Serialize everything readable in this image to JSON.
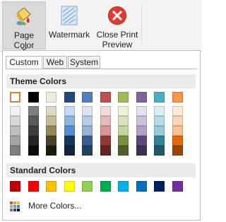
{
  "ribbon": {
    "buttons": [
      {
        "label": "Page Color",
        "icon": "paint-bucket-icon"
      },
      {
        "label": "Watermark",
        "icon": "watermark-icon"
      },
      {
        "label": "Close Print\nPreview",
        "icon": "close-icon"
      }
    ]
  },
  "tabs": [
    "Custom",
    "Web",
    "System"
  ],
  "sections": {
    "theme_title": "Theme Colors",
    "standard_title": "Standard Colors"
  },
  "theme_colors": {
    "top_row": [
      "#ffffff",
      "#000000",
      "#eeece1",
      "#1f497d",
      "#4f81bd",
      "#c0504d",
      "#9bbb59",
      "#8064a2",
      "#4bacc6",
      "#f79646"
    ],
    "shades": [
      [
        "#f2f2f2",
        "#d8d8d8",
        "#bfbfbf",
        "#a5a5a5",
        "#7f7f7f"
      ],
      [
        "#7f7f7f",
        "#595959",
        "#3f3f3f",
        "#262626",
        "#0c0c0c"
      ],
      [
        "#ddd9c3",
        "#c4bd97",
        "#938953",
        "#494429",
        "#1d1b10"
      ],
      [
        "#c6d9f0",
        "#8db3e2",
        "#548dd4",
        "#17365d",
        "#0f243e"
      ],
      [
        "#dbe5f1",
        "#b8cce4",
        "#95b3d7",
        "#366092",
        "#244061"
      ],
      [
        "#f2dcdb",
        "#e5b9b7",
        "#d99694",
        "#953734",
        "#632423"
      ],
      [
        "#ebf1dd",
        "#d7e3bc",
        "#c3d69b",
        "#76923c",
        "#4f6128"
      ],
      [
        "#e5e0ec",
        "#ccc1d9",
        "#b2a2c7",
        "#5f497a",
        "#3f3151"
      ],
      [
        "#dbeef3",
        "#b7dde8",
        "#92cddc",
        "#31859b",
        "#205867"
      ],
      [
        "#fdeada",
        "#fbd5b5",
        "#fac08f",
        "#e36c09",
        "#974806"
      ]
    ]
  },
  "standard_colors": [
    "#c00000",
    "#ff0000",
    "#ffc000",
    "#ffff00",
    "#92d050",
    "#00b050",
    "#00b0f0",
    "#0070c0",
    "#002060",
    "#7030a0"
  ],
  "more_colors_label": "More Colors..."
}
